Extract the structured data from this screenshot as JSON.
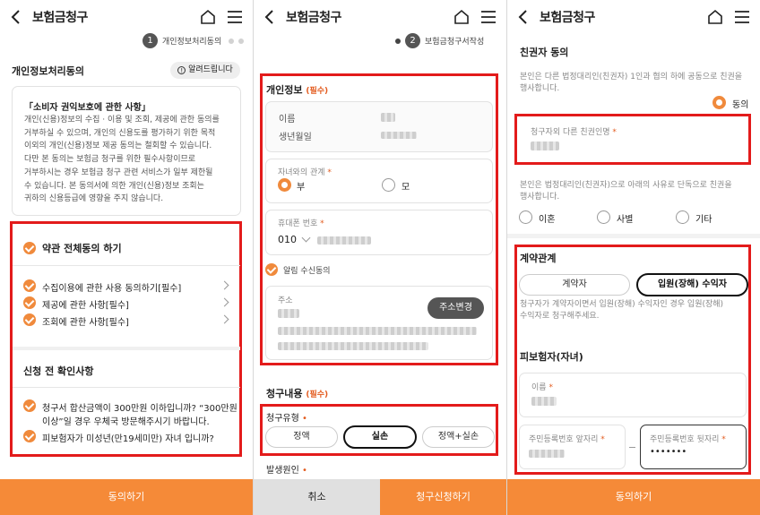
{
  "header": {
    "title": "보험금청구"
  },
  "panel1": {
    "step_number": "1",
    "step_label": "개인정보처리동의",
    "section_title": "개인정보처리동의",
    "notice_button": "알려드립니다",
    "notice_heading": "「소비자 권익보호에 관한 사항」",
    "notice_lines": [
      "개인(신용)정보의 수집 · 이용 및 조회, 제공에 관한 동의를",
      "거부하실 수 있으며, 개인의 신용도를 평가하기 위한 목적",
      "이외의 개인(신용)정보 제공 동의는 철회할 수 있습니다.",
      "다만 본 동의는 보험금 청구를 위한 필수사항이므로",
      "거부하시는 경우 보험금 청구 관련 서비스가 일부 제한될",
      "수 있습니다. 본 동의서에 의한 개인(신용)정보 조회는",
      "귀하의 신용등급에 영향을 주지 않습니다."
    ],
    "agree_all": "약관 전체동의 하기",
    "agree_items": [
      "수집이용에 관한 사용 동의하기[필수]",
      "제공에 관한 사항[필수]",
      "조회에 관한 사항[필수]"
    ],
    "confirm_title": "신청 전 확인사항",
    "confirm_items": [
      [
        "청구서 합산금액이 300만원 이하입니까? “300만원",
        "이상”일 경우 우체국 방문해주시기 바랍니다."
      ],
      [
        "피보험자가 미성년(만19세미만) 자녀 입니까?"
      ]
    ],
    "bottom_button": "동의하기"
  },
  "panel2": {
    "step_number": "2",
    "step_label": "보험금청구서작성",
    "personal_title": "개인정보",
    "required_tag": "(필수)",
    "name_label": "이름",
    "birth_label": "생년월일",
    "relation_label": "자녀와의 관계",
    "relation_options": [
      "부",
      "모"
    ],
    "phone_label": "휴대폰 번호",
    "phone_prefix": "010",
    "notify_label": "알림 수신동의",
    "address_label": "주소",
    "address_button": "주소변경",
    "claim_title": "청구내용",
    "claim_type_label": "청구유형",
    "claim_types": [
      "정액",
      "실손",
      "정액+실손"
    ],
    "cause_label": "발생원인",
    "cancel_button": "취소",
    "submit_button": "청구신청하기"
  },
  "panel3": {
    "consent_title": "친권자 동의",
    "consent_desc": [
      "본인은 다른 법정대리인(친권자) 1인과 협의 하에 공동으로 친권을",
      "행사합니다."
    ],
    "consent_option": "동의",
    "other_parent_label": "청구자외 다른 친권인명",
    "sole_desc": [
      "본인은 법정대리인(친권자)으로 아래의 사유로 단독으로 친권을",
      "행사합니다."
    ],
    "sole_options": [
      "이혼",
      "사별",
      "기타"
    ],
    "contract_title": "계약관계",
    "contract_options": [
      "계약자",
      "입원(장해) 수익자"
    ],
    "contract_desc": [
      "청구자가 계약자이면서 입원(장해) 수익자인 경우 입원(장해)",
      "수익자로 청구해주세요."
    ],
    "insured_title": "피보험자(자녀)",
    "insured_name_label": "이름",
    "rrn_front_label": "주민등록번호 앞자리",
    "rrn_back_label": "주민등록번호 뒷자리",
    "rrn_back_value": "•••••••",
    "bottom_button": "동의하기"
  },
  "colors": {
    "accent": "#f58a38",
    "highlight": "#e31b1b",
    "check": "#f08a3c"
  }
}
